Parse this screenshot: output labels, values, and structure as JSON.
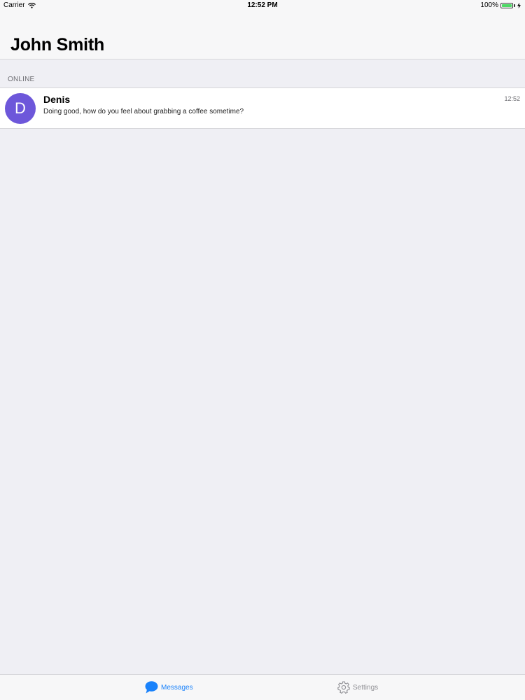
{
  "status_bar": {
    "carrier": "Carrier",
    "time": "12:52 PM",
    "battery": "100%",
    "battery_level": 1.0,
    "battery_color": "#4cd964"
  },
  "header": {
    "title": "John Smith"
  },
  "section": {
    "label": "ONLINE"
  },
  "conversations": [
    {
      "avatar_initial": "D",
      "avatar_color": "#6d57da",
      "name": "Denis",
      "preview": "Doing good, how do you feel about grabbing a coffee sometime?",
      "time": "12:52"
    }
  ],
  "tab_bar": {
    "tabs": [
      {
        "label": "Messages",
        "icon": "message-bubble-icon",
        "active": true
      },
      {
        "label": "Settings",
        "icon": "gear-icon",
        "active": false
      }
    ],
    "active_color": "#1a82fb",
    "inactive_color": "#8e8e93"
  }
}
